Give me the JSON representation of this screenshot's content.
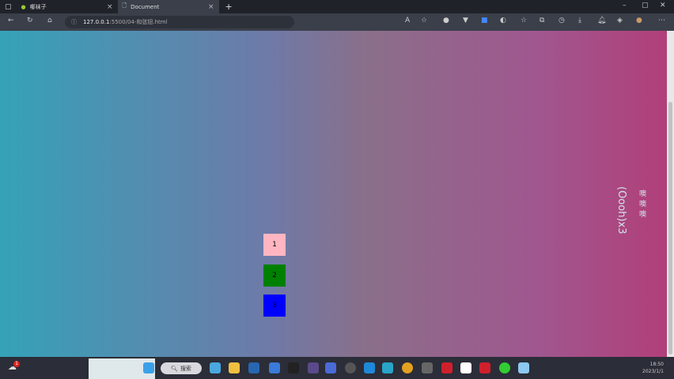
{
  "tabs": [
    {
      "label": "哪袜子"
    },
    {
      "label": "Document"
    }
  ],
  "address": {
    "host": "127.0.0.1",
    "path": ":5500/04-和弦钮.html"
  },
  "page": {
    "boxes": [
      {
        "label": "1",
        "color": "#ffb6c1"
      },
      {
        "label": "2",
        "color": "#008000"
      },
      {
        "label": "3",
        "color": "#0000ff"
      }
    ],
    "vertical_text": "(Oooh)x3",
    "vertical_cn": "噢噢噢"
  },
  "taskbar": {
    "search_label": "搜索",
    "weather_badge": "1",
    "time": "18:50",
    "date": "2023/1/1"
  }
}
